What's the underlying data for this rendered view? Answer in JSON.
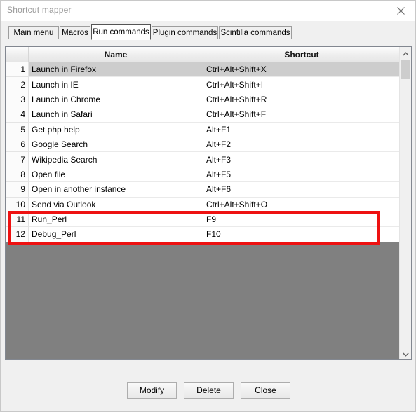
{
  "window": {
    "title": "Shortcut mapper",
    "close_icon": "close-icon"
  },
  "tabs": [
    {
      "label": "Main menu",
      "selected": false
    },
    {
      "label": "Macros",
      "selected": false
    },
    {
      "label": "Run commands",
      "selected": true
    },
    {
      "label": "Plugin commands",
      "selected": false
    },
    {
      "label": "Scintilla commands",
      "selected": false
    }
  ],
  "table": {
    "columns": {
      "index": "",
      "name": "Name",
      "shortcut": "Shortcut"
    },
    "rows": [
      {
        "index": "1",
        "name": "Launch in Firefox",
        "shortcut": "Ctrl+Alt+Shift+X",
        "selected": true,
        "highlighted": false
      },
      {
        "index": "2",
        "name": "Launch in IE",
        "shortcut": "Ctrl+Alt+Shift+I",
        "selected": false,
        "highlighted": false
      },
      {
        "index": "3",
        "name": "Launch in Chrome",
        "shortcut": "Ctrl+Alt+Shift+R",
        "selected": false,
        "highlighted": false
      },
      {
        "index": "4",
        "name": "Launch in Safari",
        "shortcut": "Ctrl+Alt+Shift+F",
        "selected": false,
        "highlighted": false
      },
      {
        "index": "5",
        "name": "Get php help",
        "shortcut": "Alt+F1",
        "selected": false,
        "highlighted": false
      },
      {
        "index": "6",
        "name": "Google Search",
        "shortcut": "Alt+F2",
        "selected": false,
        "highlighted": false
      },
      {
        "index": "7",
        "name": "Wikipedia Search",
        "shortcut": "Alt+F3",
        "selected": false,
        "highlighted": false
      },
      {
        "index": "8",
        "name": "Open file",
        "shortcut": "Alt+F5",
        "selected": false,
        "highlighted": false
      },
      {
        "index": "9",
        "name": "Open in another instance",
        "shortcut": "Alt+F6",
        "selected": false,
        "highlighted": false
      },
      {
        "index": "10",
        "name": "Send via Outlook",
        "shortcut": "Ctrl+Alt+Shift+O",
        "selected": false,
        "highlighted": false
      },
      {
        "index": "11",
        "name": "Run_Perl",
        "shortcut": "F9",
        "selected": false,
        "highlighted": true
      },
      {
        "index": "12",
        "name": "Debug_Perl",
        "shortcut": "F10",
        "selected": false,
        "highlighted": true
      }
    ]
  },
  "annotation": {
    "color": "#ee1111",
    "covers_rows": [
      "11",
      "12"
    ]
  },
  "scrollbar": {
    "up_arrow_icon": "chevron-up-icon",
    "down_arrow_icon": "chevron-down-icon"
  },
  "footer": {
    "modify_label": "Modify",
    "delete_label": "Delete",
    "close_label": "Close"
  }
}
